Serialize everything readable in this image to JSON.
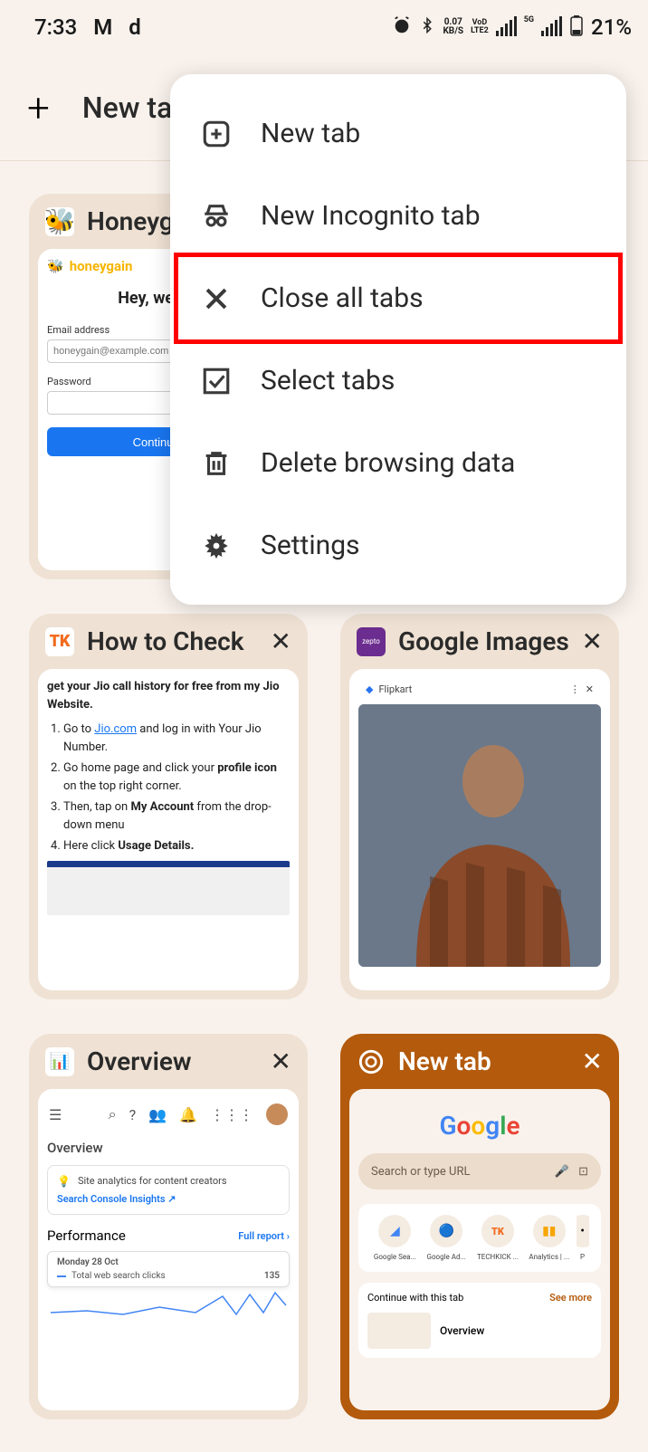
{
  "status": {
    "time": "7:33",
    "kbs_top": "0.07",
    "kbs_bottom": "KB/S",
    "net1_top": "VoD",
    "net1_bottom": "LTE2",
    "net2": "5G",
    "battery": "21%"
  },
  "appbar": {
    "title": "New tab"
  },
  "menu": {
    "new_tab": "New tab",
    "new_incognito": "New Incognito tab",
    "close_all": "Close all tabs",
    "select_tabs": "Select tabs",
    "delete_data": "Delete browsing data",
    "settings": "Settings"
  },
  "tabs": {
    "honeygain": {
      "title": "Honeygain",
      "brand": "honeygain",
      "welcome": "Hey, welcome",
      "email_label": "Email address",
      "email_placeholder": "honeygain@example.com",
      "password_label": "Password",
      "continue": "Continue with"
    },
    "howto": {
      "title": "How to Check",
      "intro": "get your Jio call history for free from my Jio Website.",
      "step1_pre": "Go to ",
      "step1_link": "Jio.com",
      "step1_post": " and log in with Your Jio Number.",
      "step2_pre": "Go home page and click your ",
      "step2_bold": "profile icon",
      "step2_post": " on the top right corner.",
      "step3_pre": "Then, tap on ",
      "step3_bold": "My Account",
      "step3_post": " from the drop-down menu",
      "step4_pre": "Here click ",
      "step4_bold": "Usage Details."
    },
    "gimages": {
      "title": "Google Images",
      "flipkart": "Flipkart"
    },
    "overview": {
      "title": "Overview",
      "heading": "Overview",
      "insights_text": "Site analytics for content creators",
      "insights_link": "Search Console Insights",
      "performance": "Performance",
      "full_report": "Full report",
      "popup_date": "Monday 28 Oct",
      "popup_metric": "Total web search clicks",
      "popup_value": "135"
    },
    "newtab": {
      "title": "New tab",
      "search_placeholder": "Search or type URL",
      "shortcuts": [
        {
          "label": "Google Sea..."
        },
        {
          "label": "Google Ad..."
        },
        {
          "label": "TECHKICK ..."
        },
        {
          "label": "Analytics | ..."
        },
        {
          "label": "P"
        }
      ],
      "continue_title": "Continue with this tab",
      "see_more": "See more",
      "cont_overview": "Overview"
    }
  }
}
